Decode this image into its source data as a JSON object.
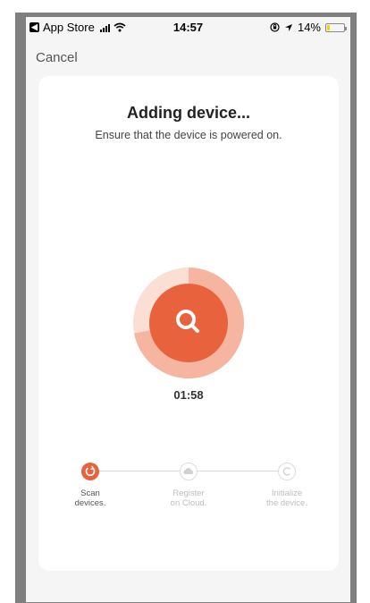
{
  "status_bar": {
    "back_app": "App Store",
    "time": "14:57",
    "battery": "14%",
    "battery_level": 0.14
  },
  "nav": {
    "cancel_label": "Cancel"
  },
  "card": {
    "title": "Adding device...",
    "subtitle": "Ensure that the device is powered on.",
    "timer": "01:58",
    "progress_fraction": 0.72
  },
  "steps": [
    {
      "label_line1": "Scan",
      "label_line2": "devices.",
      "state": "active"
    },
    {
      "label_line1": "Register",
      "label_line2": "on Cloud.",
      "state": "pending"
    },
    {
      "label_line1": "Initialize",
      "label_line2": "the device.",
      "state": "pending"
    }
  ],
  "colors": {
    "accent": "#e8623d",
    "accent_light": "#f5b5a0",
    "ring_pale": "#fbded4",
    "inactive": "#c8c8c8"
  },
  "icons": {
    "status_back": "back-to-app-icon",
    "signal": "signal-icon",
    "wifi": "wifi-icon",
    "orientation": "orientation-lock-icon",
    "location": "location-icon",
    "battery": "battery-icon",
    "scan": "magnifier-icon",
    "step1": "refresh-icon",
    "step2": "cloud-icon",
    "step3": "restart-icon"
  }
}
